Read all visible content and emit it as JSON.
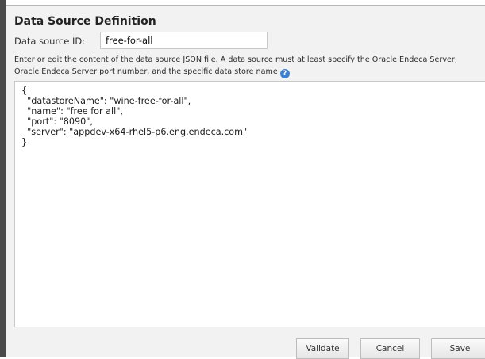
{
  "dialog": {
    "title": "Data Source Definition",
    "id_label": "Data source ID:",
    "id_value": "free-for-all",
    "instructions": "Enter or edit the content of the data source JSON file. A data source must at least specify the Oracle Endeca Server, Oracle Endeca Server port number, and the specific data store name",
    "help_icon": "?",
    "json_content": "{\n  \"datastoreName\": \"wine-free-for-all\",\n  \"name\": \"free for all\",\n  \"port\": \"8090\",\n  \"server\": \"appdev-x64-rhel5-p6.eng.endeca.com\"\n}"
  },
  "buttons": {
    "validate": "Validate",
    "cancel": "Cancel",
    "save": "Save"
  },
  "colors": {
    "dialog_background": "#f2f2f2",
    "help_icon": "#3f7fd0",
    "left_edge": "#4a4a4a"
  },
  "icons": {
    "help": "help-circle-icon"
  }
}
